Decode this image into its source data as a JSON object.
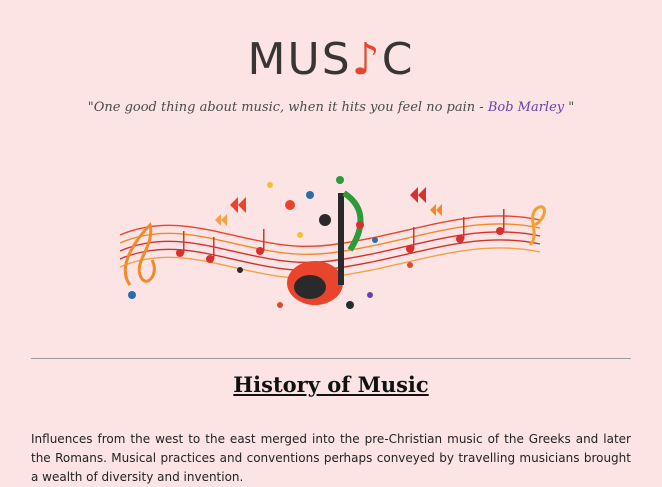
{
  "header": {
    "logo_left": "MUS",
    "logo_note": "♪",
    "logo_right": "C"
  },
  "quote": {
    "text": "\"One good thing about music, when it hits you feel no pain - ",
    "author": "Bob Marley",
    "close": " \""
  },
  "banner": {
    "icon": "music-notes-illustration-icon"
  },
  "section": {
    "title": "History of Music",
    "body": "Influences from the west to the east merged into the pre-Christian music of the Greeks and later the Romans. Musical practices and conventions perhaps conveyed by travelling musicians brought a wealth of diversity and invention."
  },
  "colors": {
    "background": "#fce4e4",
    "logo": "#3a3535",
    "accent": "#e8452c",
    "author_link": "#6a3fb0"
  }
}
